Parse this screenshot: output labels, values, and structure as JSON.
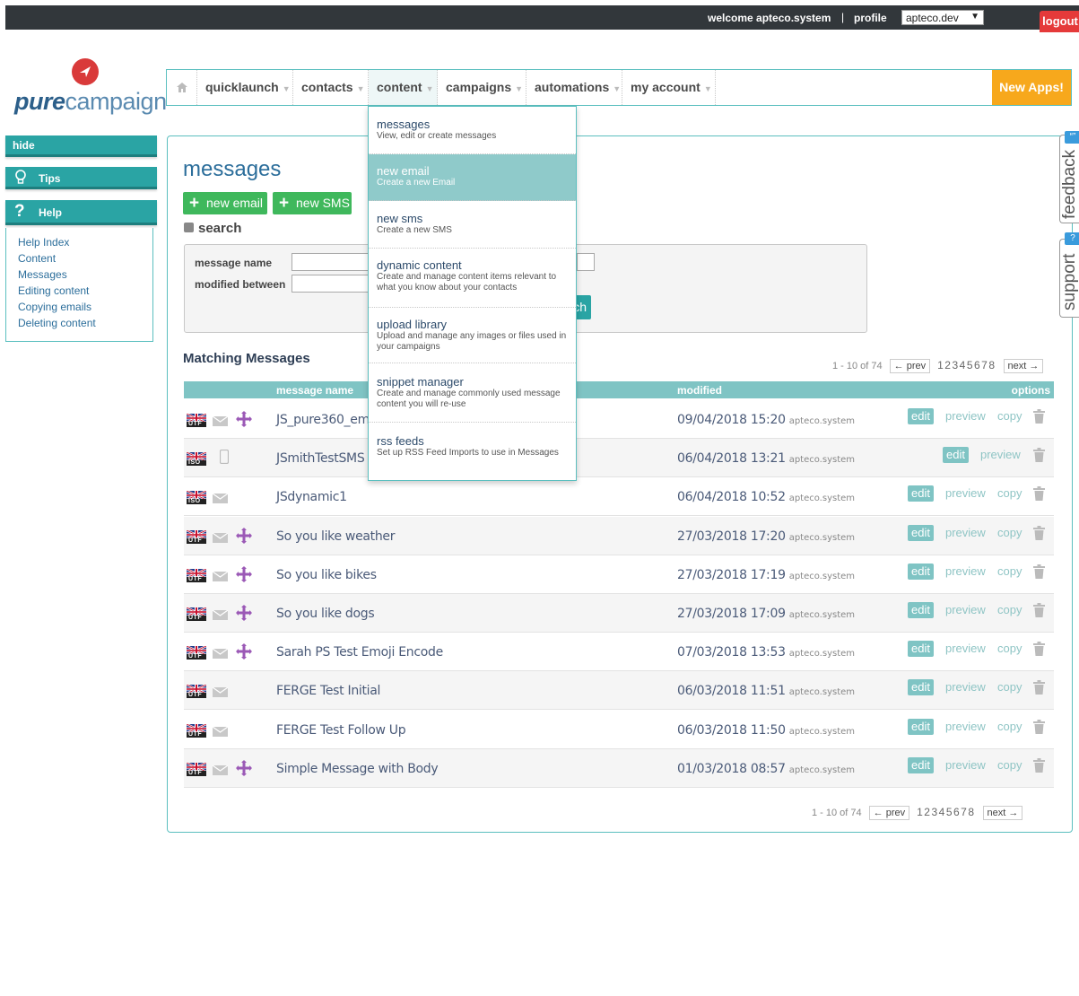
{
  "topbar": {
    "welcome": "welcome apteco.system",
    "separator": "|",
    "profile": "profile",
    "environment": "apteco.dev",
    "logout": "logout"
  },
  "logo": {
    "bold": "pure",
    "light": "campaign"
  },
  "nav": {
    "items": [
      {
        "label": "quicklaunch"
      },
      {
        "label": "contacts"
      },
      {
        "label": "content"
      },
      {
        "label": "campaigns"
      },
      {
        "label": "automations"
      },
      {
        "label": "my account"
      }
    ],
    "new_apps": "New Apps!"
  },
  "sidebar": {
    "hide": "hide",
    "tips": "Tips",
    "help": "Help",
    "help_links": [
      "Help Index",
      "Content",
      "Messages",
      "Editing content",
      "Copying emails",
      "Deleting content"
    ]
  },
  "page": {
    "title": "messages",
    "new_email": "new email",
    "new_sms": "new SMS",
    "search_toggle": "search",
    "search": {
      "name_label": "message name",
      "modified_label": "modified between",
      "button": "ch"
    },
    "matching": "Matching Messages"
  },
  "pager": {
    "count": "1 - 10 of 74",
    "prev": "← prev",
    "pages": "12345678",
    "next": "next →"
  },
  "table": {
    "headers": {
      "name": "message name",
      "modified": "modified",
      "options": "options"
    },
    "rows": [
      {
        "name": "JS_pure360_ema",
        "date": "09/04/2018 15:20",
        "user": "apteco.system",
        "type": "email",
        "flag": "UTF",
        "automation": true,
        "copy": true
      },
      {
        "name": "JSmithTestSMS",
        "date": "06/04/2018 13:21",
        "user": "apteco.system",
        "type": "sms",
        "flag": "ISO",
        "automation": false,
        "copy": false
      },
      {
        "name": "JSdynamic1",
        "date": "06/04/2018 10:52",
        "user": "apteco.system",
        "type": "email",
        "flag": "ISO",
        "automation": false,
        "copy": true
      },
      {
        "name": "So you like weather",
        "date": "27/03/2018 17:20",
        "user": "apteco.system",
        "type": "email",
        "flag": "UTF",
        "automation": true,
        "copy": true
      },
      {
        "name": "So you like bikes",
        "date": "27/03/2018 17:19",
        "user": "apteco.system",
        "type": "email",
        "flag": "UTF",
        "automation": true,
        "copy": true
      },
      {
        "name": "So you like dogs",
        "date": "27/03/2018 17:09",
        "user": "apteco.system",
        "type": "email",
        "flag": "UTF",
        "automation": true,
        "copy": true
      },
      {
        "name": "Sarah PS Test Emoji Encode",
        "date": "07/03/2018 13:53",
        "user": "apteco.system",
        "type": "email",
        "flag": "UTF",
        "automation": true,
        "copy": true
      },
      {
        "name": "FERGE Test Initial",
        "date": "06/03/2018 11:51",
        "user": "apteco.system",
        "type": "email",
        "flag": "UTF",
        "automation": false,
        "copy": true
      },
      {
        "name": "FERGE Test Follow Up",
        "date": "06/03/2018 11:50",
        "user": "apteco.system",
        "type": "email",
        "flag": "UTF",
        "automation": false,
        "copy": true
      },
      {
        "name": "Simple Message with Body",
        "date": "01/03/2018 08:57",
        "user": "apteco.system",
        "type": "email",
        "flag": "UTF",
        "automation": true,
        "copy": true
      }
    ],
    "actions": {
      "edit": "edit",
      "preview": "preview",
      "copy": "copy"
    }
  },
  "dropdown": {
    "items": [
      {
        "title": "messages",
        "desc": "View, edit or create messages"
      },
      {
        "title": "new email",
        "desc": "Create a new Email"
      },
      {
        "title": "new sms",
        "desc": "Create a new SMS"
      },
      {
        "title": "dynamic content",
        "desc": "Create and manage content items relevant to what you know about your contacts"
      },
      {
        "title": "upload library",
        "desc": "Upload and manage any images or files used in your campaigns"
      },
      {
        "title": "snippet manager",
        "desc": "Create and manage commonly used message content you will re-use"
      },
      {
        "title": "rss feeds",
        "desc": "Set up RSS Feed Imports to use in Messages"
      }
    ]
  },
  "side_tabs": {
    "feedback": "feedback",
    "feedback_badge": "“”",
    "support": "support",
    "support_badge": "?"
  },
  "colors": {
    "teal": "#2aa4a4",
    "green": "#3fb85c",
    "orange": "#f7a81c",
    "logout_red": "#e53a3a",
    "topbar": "#32373b"
  }
}
